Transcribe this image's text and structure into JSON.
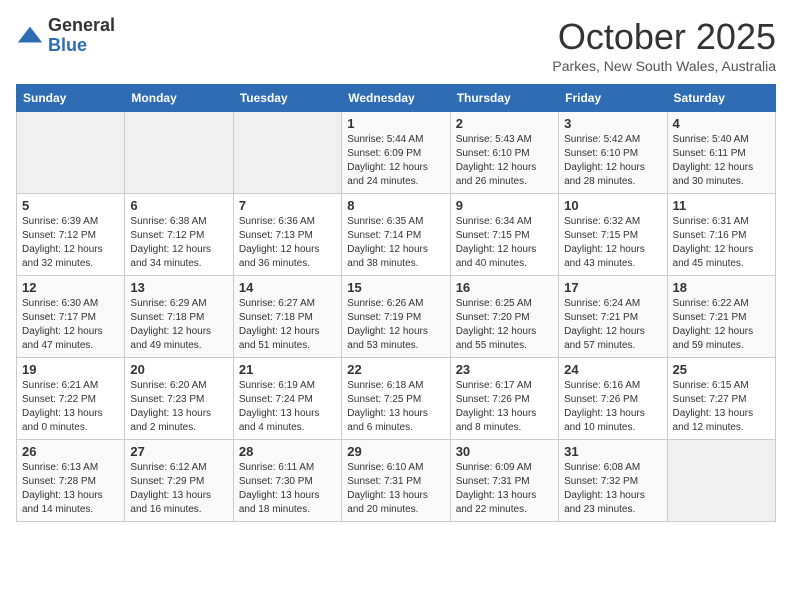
{
  "logo": {
    "general": "General",
    "blue": "Blue"
  },
  "title": "October 2025",
  "subtitle": "Parkes, New South Wales, Australia",
  "days_of_week": [
    "Sunday",
    "Monday",
    "Tuesday",
    "Wednesday",
    "Thursday",
    "Friday",
    "Saturday"
  ],
  "weeks": [
    [
      {
        "day": "",
        "info": ""
      },
      {
        "day": "",
        "info": ""
      },
      {
        "day": "",
        "info": ""
      },
      {
        "day": "1",
        "info": "Sunrise: 5:44 AM\nSunset: 6:09 PM\nDaylight: 12 hours\nand 24 minutes."
      },
      {
        "day": "2",
        "info": "Sunrise: 5:43 AM\nSunset: 6:10 PM\nDaylight: 12 hours\nand 26 minutes."
      },
      {
        "day": "3",
        "info": "Sunrise: 5:42 AM\nSunset: 6:10 PM\nDaylight: 12 hours\nand 28 minutes."
      },
      {
        "day": "4",
        "info": "Sunrise: 5:40 AM\nSunset: 6:11 PM\nDaylight: 12 hours\nand 30 minutes."
      }
    ],
    [
      {
        "day": "5",
        "info": "Sunrise: 6:39 AM\nSunset: 7:12 PM\nDaylight: 12 hours\nand 32 minutes."
      },
      {
        "day": "6",
        "info": "Sunrise: 6:38 AM\nSunset: 7:12 PM\nDaylight: 12 hours\nand 34 minutes."
      },
      {
        "day": "7",
        "info": "Sunrise: 6:36 AM\nSunset: 7:13 PM\nDaylight: 12 hours\nand 36 minutes."
      },
      {
        "day": "8",
        "info": "Sunrise: 6:35 AM\nSunset: 7:14 PM\nDaylight: 12 hours\nand 38 minutes."
      },
      {
        "day": "9",
        "info": "Sunrise: 6:34 AM\nSunset: 7:15 PM\nDaylight: 12 hours\nand 40 minutes."
      },
      {
        "day": "10",
        "info": "Sunrise: 6:32 AM\nSunset: 7:15 PM\nDaylight: 12 hours\nand 43 minutes."
      },
      {
        "day": "11",
        "info": "Sunrise: 6:31 AM\nSunset: 7:16 PM\nDaylight: 12 hours\nand 45 minutes."
      }
    ],
    [
      {
        "day": "12",
        "info": "Sunrise: 6:30 AM\nSunset: 7:17 PM\nDaylight: 12 hours\nand 47 minutes."
      },
      {
        "day": "13",
        "info": "Sunrise: 6:29 AM\nSunset: 7:18 PM\nDaylight: 12 hours\nand 49 minutes."
      },
      {
        "day": "14",
        "info": "Sunrise: 6:27 AM\nSunset: 7:18 PM\nDaylight: 12 hours\nand 51 minutes."
      },
      {
        "day": "15",
        "info": "Sunrise: 6:26 AM\nSunset: 7:19 PM\nDaylight: 12 hours\nand 53 minutes."
      },
      {
        "day": "16",
        "info": "Sunrise: 6:25 AM\nSunset: 7:20 PM\nDaylight: 12 hours\nand 55 minutes."
      },
      {
        "day": "17",
        "info": "Sunrise: 6:24 AM\nSunset: 7:21 PM\nDaylight: 12 hours\nand 57 minutes."
      },
      {
        "day": "18",
        "info": "Sunrise: 6:22 AM\nSunset: 7:21 PM\nDaylight: 12 hours\nand 59 minutes."
      }
    ],
    [
      {
        "day": "19",
        "info": "Sunrise: 6:21 AM\nSunset: 7:22 PM\nDaylight: 13 hours\nand 0 minutes."
      },
      {
        "day": "20",
        "info": "Sunrise: 6:20 AM\nSunset: 7:23 PM\nDaylight: 13 hours\nand 2 minutes."
      },
      {
        "day": "21",
        "info": "Sunrise: 6:19 AM\nSunset: 7:24 PM\nDaylight: 13 hours\nand 4 minutes."
      },
      {
        "day": "22",
        "info": "Sunrise: 6:18 AM\nSunset: 7:25 PM\nDaylight: 13 hours\nand 6 minutes."
      },
      {
        "day": "23",
        "info": "Sunrise: 6:17 AM\nSunset: 7:26 PM\nDaylight: 13 hours\nand 8 minutes."
      },
      {
        "day": "24",
        "info": "Sunrise: 6:16 AM\nSunset: 7:26 PM\nDaylight: 13 hours\nand 10 minutes."
      },
      {
        "day": "25",
        "info": "Sunrise: 6:15 AM\nSunset: 7:27 PM\nDaylight: 13 hours\nand 12 minutes."
      }
    ],
    [
      {
        "day": "26",
        "info": "Sunrise: 6:13 AM\nSunset: 7:28 PM\nDaylight: 13 hours\nand 14 minutes."
      },
      {
        "day": "27",
        "info": "Sunrise: 6:12 AM\nSunset: 7:29 PM\nDaylight: 13 hours\nand 16 minutes."
      },
      {
        "day": "28",
        "info": "Sunrise: 6:11 AM\nSunset: 7:30 PM\nDaylight: 13 hours\nand 18 minutes."
      },
      {
        "day": "29",
        "info": "Sunrise: 6:10 AM\nSunset: 7:31 PM\nDaylight: 13 hours\nand 20 minutes."
      },
      {
        "day": "30",
        "info": "Sunrise: 6:09 AM\nSunset: 7:31 PM\nDaylight: 13 hours\nand 22 minutes."
      },
      {
        "day": "31",
        "info": "Sunrise: 6:08 AM\nSunset: 7:32 PM\nDaylight: 13 hours\nand 23 minutes."
      },
      {
        "day": "",
        "info": ""
      }
    ]
  ]
}
